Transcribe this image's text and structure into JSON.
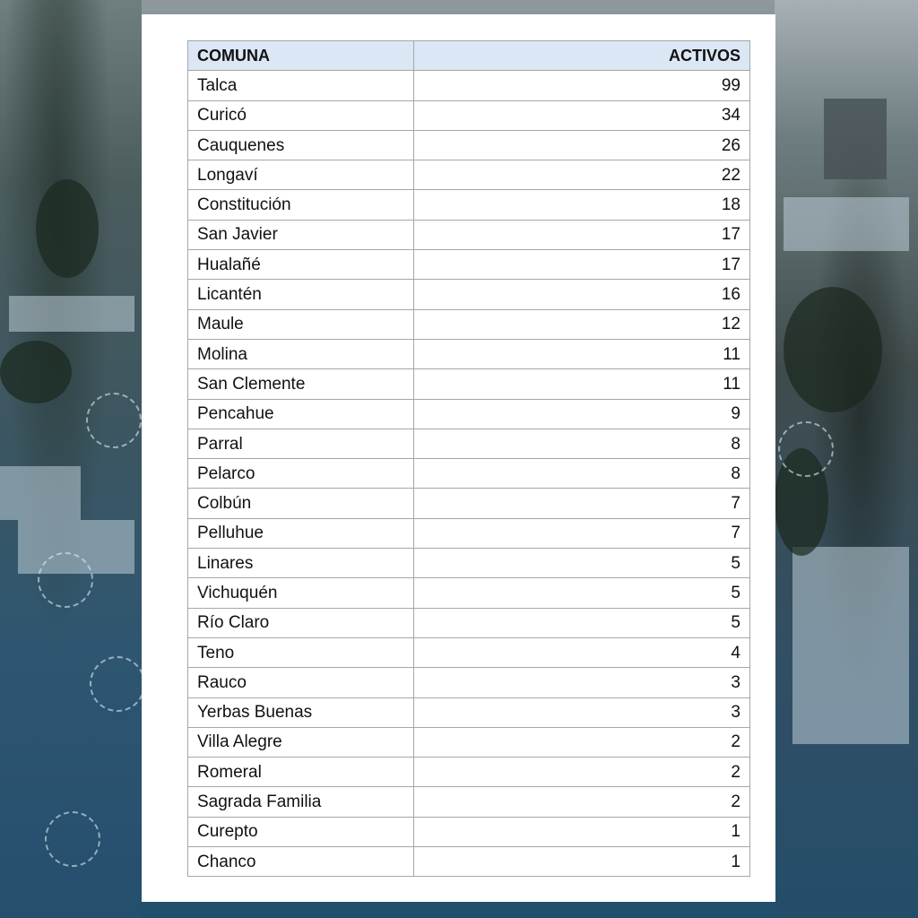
{
  "table": {
    "headers": {
      "comuna": "COMUNA",
      "activos": "ACTIVOS"
    },
    "rows": [
      {
        "comuna": "Talca",
        "activos": "99"
      },
      {
        "comuna": "Curicó",
        "activos": "34"
      },
      {
        "comuna": "Cauquenes",
        "activos": "26"
      },
      {
        "comuna": "Longaví",
        "activos": "22"
      },
      {
        "comuna": "Constitución",
        "activos": "18"
      },
      {
        "comuna": "San Javier",
        "activos": "17"
      },
      {
        "comuna": "Hualañé",
        "activos": "17"
      },
      {
        "comuna": "Licantén",
        "activos": "16"
      },
      {
        "comuna": "Maule",
        "activos": "12"
      },
      {
        "comuna": "Molina",
        "activos": "11"
      },
      {
        "comuna": "San Clemente",
        "activos": "11"
      },
      {
        "comuna": "Pencahue",
        "activos": "9"
      },
      {
        "comuna": "Parral",
        "activos": "8"
      },
      {
        "comuna": "Pelarco",
        "activos": "8"
      },
      {
        "comuna": "Colbún",
        "activos": "7"
      },
      {
        "comuna": "Pelluhue",
        "activos": "7"
      },
      {
        "comuna": "Linares",
        "activos": "5"
      },
      {
        "comuna": "Vichuquén",
        "activos": "5"
      },
      {
        "comuna": "Río Claro",
        "activos": "5"
      },
      {
        "comuna": "Teno",
        "activos": "4"
      },
      {
        "comuna": "Rauco",
        "activos": "3"
      },
      {
        "comuna": "Yerbas Buenas",
        "activos": "3"
      },
      {
        "comuna": "Villa Alegre",
        "activos": "2"
      },
      {
        "comuna": "Romeral",
        "activos": "2"
      },
      {
        "comuna": "Sagrada Familia",
        "activos": "2"
      },
      {
        "comuna": "Curepto",
        "activos": "1"
      },
      {
        "comuna": "Chanco",
        "activos": "1"
      }
    ]
  },
  "colors": {
    "header_bg": "#dbe7f5",
    "grid": "#a6a6a6",
    "background_tint": "#2f5d78"
  },
  "decor": {
    "background": "city-aerial-photo",
    "icons": [
      "virus-icon"
    ]
  }
}
